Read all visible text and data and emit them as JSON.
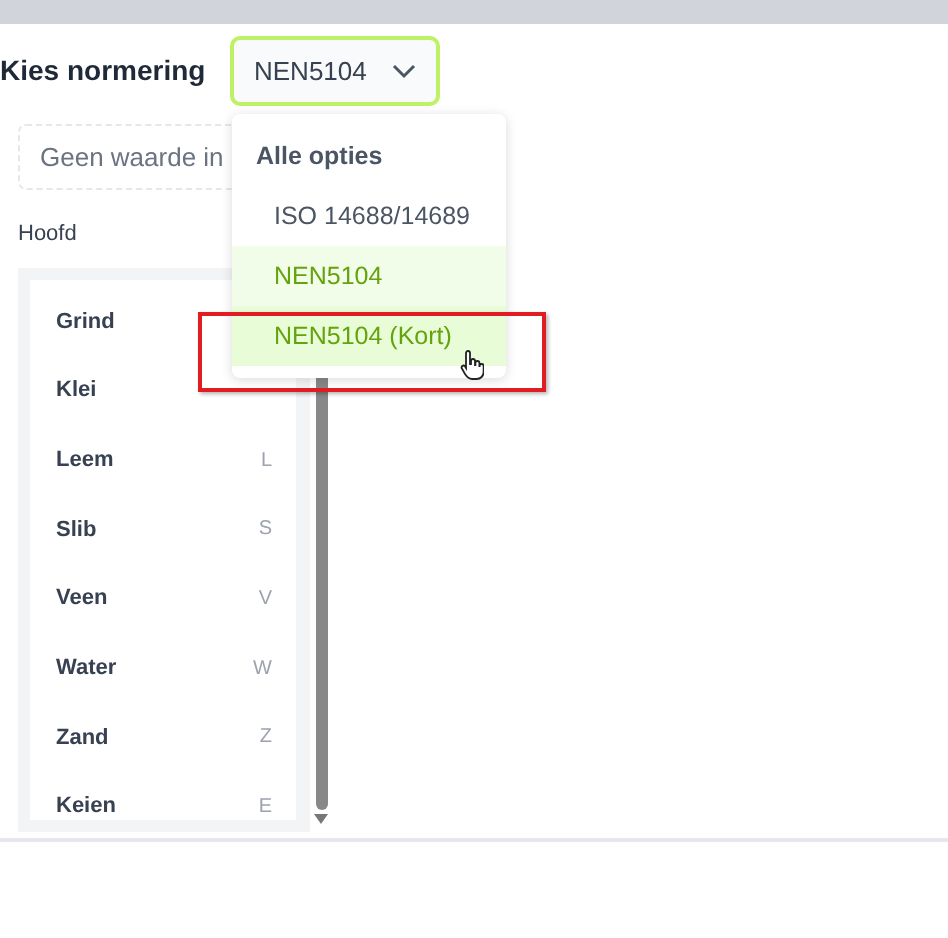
{
  "heading": "Kies normering",
  "select": {
    "value": "NEN5104",
    "open": true
  },
  "search": {
    "placeholder": "Geen waarde in"
  },
  "group_label": "Hoofd",
  "items": [
    {
      "label": "Grind"
    },
    {
      "label": "Klei"
    },
    {
      "label": "Leem",
      "key": "L"
    },
    {
      "label": "Slib",
      "key": "S"
    },
    {
      "label": "Veen",
      "key": "V"
    },
    {
      "label": "Water",
      "key": "W"
    },
    {
      "label": "Zand",
      "key": "Z"
    },
    {
      "label": "Keien",
      "key": "E"
    }
  ],
  "dropdown": {
    "header": "Alle opties",
    "options": [
      {
        "label": "ISO 14688/14689",
        "selected": false,
        "hovered": false
      },
      {
        "label": "NEN5104",
        "selected": true,
        "hovered": false
      },
      {
        "label": "NEN5104 (Kort)",
        "selected": false,
        "hovered": true
      }
    ]
  }
}
